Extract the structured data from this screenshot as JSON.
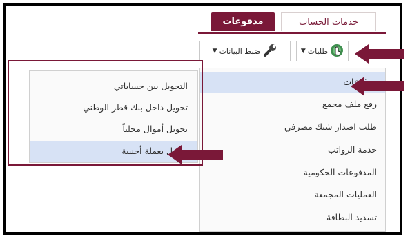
{
  "tabs": {
    "account_services": "خدمات الحساب",
    "payments": "مدفوعات"
  },
  "toolbar": {
    "requests_label": "طلبات",
    "data_settings_label": "ضبط البيانات",
    "dropdown_glyph": "▼"
  },
  "menu": {
    "items": [
      {
        "label": "مدفوعات",
        "active": true
      },
      {
        "label": "رفع ملف مجمع",
        "active": false
      },
      {
        "label": "طلب اصدار شيك مصرفي",
        "active": false
      },
      {
        "label": "خدمة الرواتب",
        "active": false
      },
      {
        "label": "المدفوعات الحكومية",
        "active": false
      },
      {
        "label": "العمليات المجمعة",
        "active": false
      },
      {
        "label": "تسديد البطاقة",
        "active": false
      }
    ]
  },
  "submenu": {
    "items": [
      {
        "label": "التحويل بين حساباتي",
        "active": false
      },
      {
        "label": "تحويل داخل بنك قطر الوطني",
        "active": false
      },
      {
        "label": "تحويل أموال محلياً",
        "active": false
      },
      {
        "label": "تحويل بعملة أجنبية",
        "active": true
      }
    ]
  },
  "colors": {
    "brand": "#7a1838",
    "highlight": "#d7e2f5"
  },
  "icons": {
    "requests": "touch-hand-icon",
    "settings": "wrench-icon",
    "annotation": "arrow-pointer-icon"
  }
}
